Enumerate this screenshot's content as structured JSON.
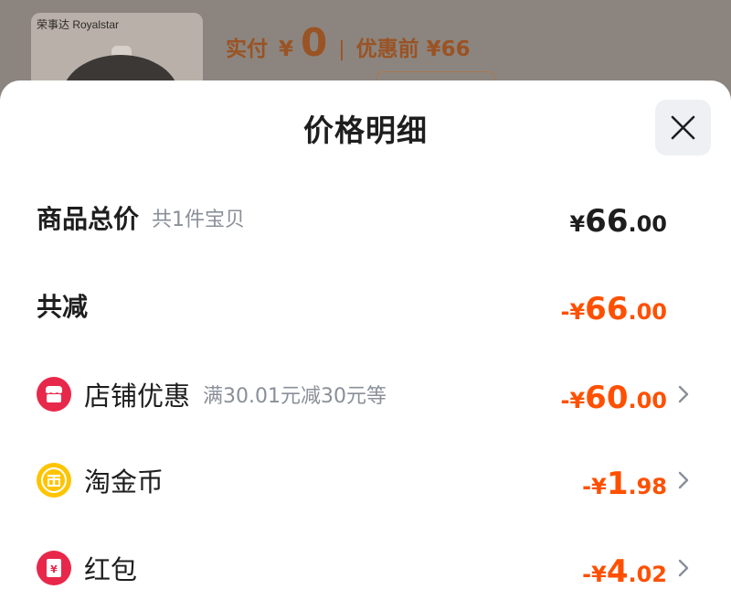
{
  "background": {
    "brand_text": "荣事达 Royalstar",
    "paid_label": "实付",
    "paid_currency": "¥",
    "paid_amount": "0",
    "separator": "|",
    "before_discount": "优惠前 ¥66"
  },
  "sheet": {
    "title": "价格明细",
    "close_icon": "close-icon"
  },
  "rows": [
    {
      "label": "商品总价",
      "sub": "共1件宝贝",
      "prefix": "¥",
      "int": "66",
      "dec": ".00",
      "color": "#1e1e1e"
    },
    {
      "label": "共减",
      "sub": "",
      "prefix": "-¥",
      "int": "66",
      "dec": ".00",
      "color": "#ff5000"
    },
    {
      "label": "店铺优惠",
      "sub": "满30.01元减30元等",
      "prefix": "-¥",
      "int": "60",
      "dec": ".00",
      "icon": "shop-icon",
      "color": "#ff5000"
    },
    {
      "label": "淘金币",
      "sub": "",
      "prefix": "-¥",
      "int": "1",
      "dec": ".98",
      "icon": "gold-coin-icon",
      "color": "#ff5000"
    },
    {
      "label": "红包",
      "sub": "",
      "prefix": "-¥",
      "int": "4",
      "dec": ".02",
      "icon": "red-packet-icon",
      "color": "#ff5000"
    }
  ],
  "colors": {
    "accent": "#ff5000",
    "text": "#1e1e1e",
    "subtext": "#8a8f99",
    "shop_icon": "#e8284a",
    "coin_icon": "#ffc400",
    "red_packet_icon": "#e8284a"
  }
}
